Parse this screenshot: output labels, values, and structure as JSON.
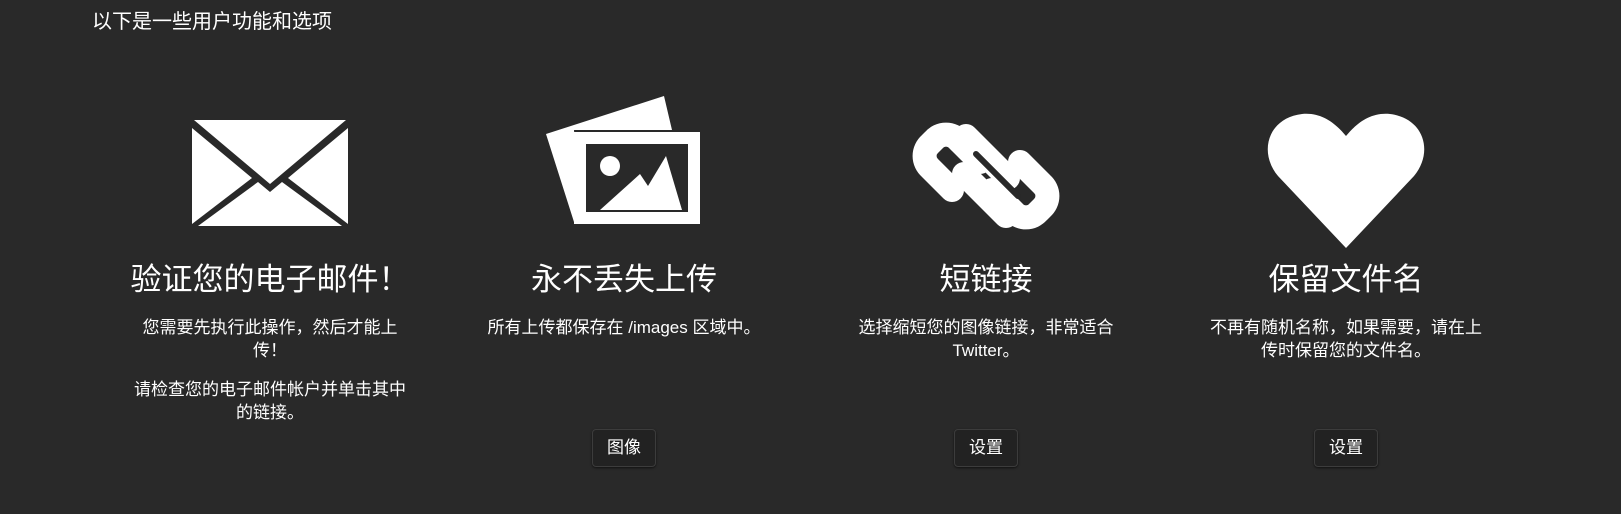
{
  "intro": "以下是一些用户功能和选项",
  "features": [
    {
      "icon": "envelope-icon",
      "title": "验证您的电子邮件！",
      "desc": [
        "您需要先执行此操作，然后才能上传！",
        "请检查您的电子邮件帐户并单击其中的链接。"
      ],
      "button": null
    },
    {
      "icon": "images-icon",
      "title": "永不丢失上传",
      "desc": [
        "所有上传都保存在 /images 区域中。"
      ],
      "button": "图像"
    },
    {
      "icon": "link-icon",
      "title": "短链接",
      "desc": [
        "选择缩短您的图像链接，非常适合 Twitter。"
      ],
      "button": "设置"
    },
    {
      "icon": "heart-icon",
      "title": "保留文件名",
      "desc": [
        "不再有随机名称，如果需要，请在上传时保留您的文件名。"
      ],
      "button": "设置"
    }
  ],
  "colors": {
    "background": "#292929",
    "text": "#ffffff",
    "button_bg": "#222222"
  }
}
